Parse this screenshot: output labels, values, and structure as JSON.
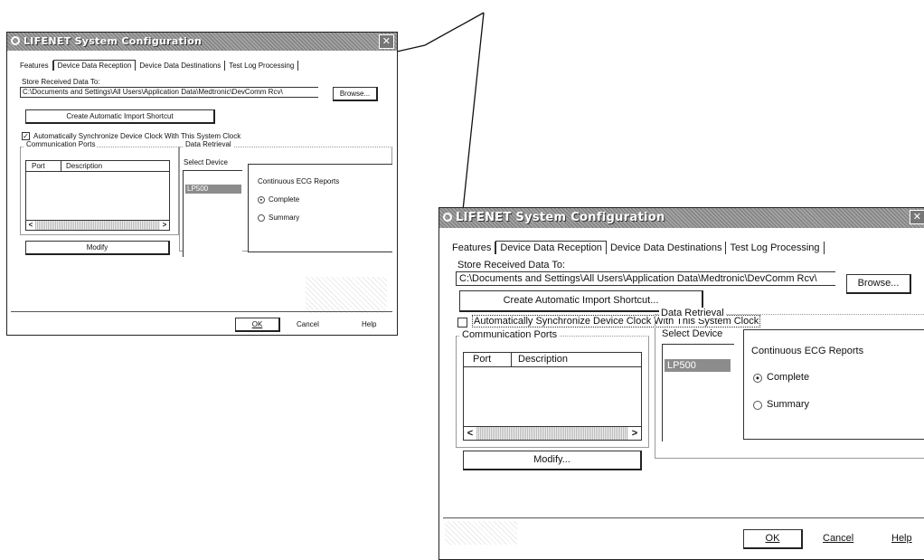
{
  "dialog": {
    "title": "LIFENET System Configuration",
    "close_glyph": "✕",
    "icon": "lifenet-app-icon",
    "tabs": [
      "Features",
      "Device Data Reception",
      "Device Data Destinations",
      "Test Log Processing"
    ],
    "active_tab": "Device Data Reception",
    "store_label": "Store Received Data To:",
    "store_path": "C:\\Documents and Settings\\All Users\\Application Data\\Medtronic\\DevComm Rcv\\",
    "store_path_large": "C:\\Documents and Settings\\All Users\\Application Data\\Medtronic\\DevComm Rcv\\",
    "browse_label": "Browse...",
    "create_shortcut_label": "Create Automatic Import Shortcut...",
    "create_shortcut_label_small": "Create Automatic Import Shortcut",
    "auto_sync_label": "Automatically Synchronize Device Clock With This System Clock",
    "auto_sync_checked_small": true,
    "auto_sync_checked_large": false,
    "comm_ports_legend": "Communication Ports",
    "columns": [
      "Port",
      "Description"
    ],
    "scroll_left": "<",
    "scroll_right": ">",
    "modify_label": "Modify...",
    "modify_label_small": "Modify",
    "data_retrieval_legend": "Data Retrieval",
    "select_device_label": "Select Device",
    "devices": [
      "LP500"
    ],
    "ecg_reports_label": "Continuous ECG Reports",
    "report_options": [
      "Complete",
      "Summary"
    ],
    "report_selected": "Complete",
    "ok_label": "OK",
    "cancel_label": "Cancel",
    "help_label": "Help"
  }
}
